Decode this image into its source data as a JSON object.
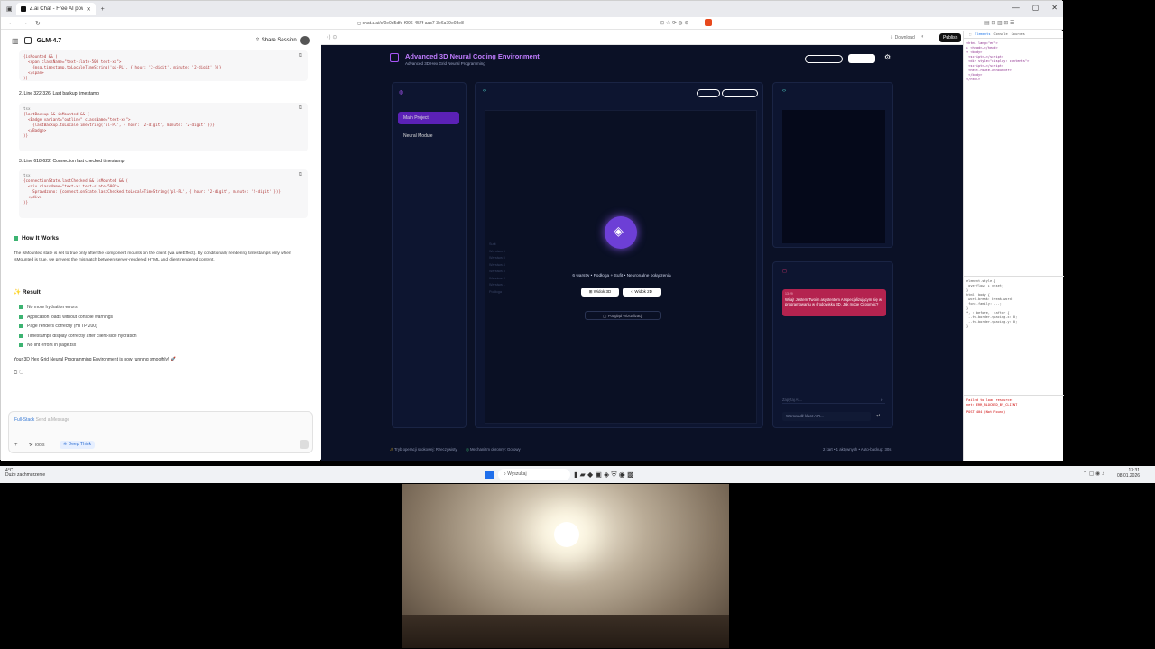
{
  "browser": {
    "tab_title": "Z.ai Chat - Free AI powered by GLM",
    "url": "chat.z.ai/c/0e0d5dfe-f096-457f-aac7-3e6a79e08e8"
  },
  "chat": {
    "model": "GLM-4.7",
    "share": "Share Session",
    "item2": "2. Line 322-326: Last backup timestamp",
    "item3": "3. Line 618-622: Connection last checked timestamp",
    "code_lang": "tsx",
    "code1": "{isMounted && (\n  <span className=\"text-slate-500 text-xs\">\n    {msg.timestamp.toLocaleTimeString('pl-PL', { hour: '2-digit', minute: '2-digit' })}\n  </span>\n)}",
    "code2": "{lastBackup && isMounted && (\n  <Badge variant=\"outline\" className=\"text-xs\">\n    {lastBackup.toLocaleTimeString('pl-PL', { hour: '2-digit', minute: '2-digit' })}\n  </Badge>\n)}",
    "code3": "{connectionState.lastChecked && isMounted && (\n  <div className=\"text-xs text-slate-500\">\n    Sprawdzono: {connectionState.lastChecked.toLocaleTimeString('pl-PL', { hour: '2-digit', minute: '2-digit' })}\n  </div>\n)}",
    "how_title": "How It Works",
    "how_text": "The isMounted state is set to true only after the component mounts on the client (via useEffect). By conditionally rendering timestamps only when isMounted is true, we prevent the mismatch between server-rendered HTML and client-rendered content.",
    "result_title": "Result",
    "results": [
      "No more hydration errors",
      "Application loads without console warnings",
      "Page renders correctly (HTTP 200)",
      "Timestamps display correctly after client-side hydration",
      "No lint errors in page.tsx"
    ],
    "final": "Your 3D Hex Grid Neural Programming Environment is now running smoothly! 🚀",
    "input_prefix": "Full-Stack",
    "input_placeholder": "Send a Message",
    "tools": "Tools",
    "deep": "Deep Think"
  },
  "app": {
    "title": "Advanced 3D Neural Coding Environment",
    "subtitle": "Advanced 3D Hex Grid Neural Programming",
    "download": "Download",
    "publish": "Publish",
    "projects": [
      "Main Project",
      "Neural Module"
    ],
    "layer_text": "6 warstw • Podłoga + Sufit • Neuronalne połączenia",
    "view3d": "Widok 3D",
    "view2d": "Widok 2D",
    "hide_vis": "Podgląd Wizualizacji",
    "layers": [
      "Sufit",
      "Warstwa 6",
      "Warstwa 5",
      "Warstwa 4",
      "Warstwa 3",
      "Warstwa 2",
      "Warstwa 1",
      "Podłoga"
    ],
    "ai_msg": "Witaj! Jestem Twoim asystentem AI specjalizującym się w programowaniu w środowisku 3D. Jak mogę Ci pomóc?",
    "ai_time": "13:29",
    "chat_placeholder": "Zapytaj AI...",
    "api_placeholder": "Wprowadź klucz API...",
    "footer_left": "Tryb operacji skokowej: Rzeczywisty",
    "footer_mid": "Mechanizm obronny: Gotowy",
    "footer_right": "2 kart • 1 aktywnych • Auto-backup: 30s"
  },
  "devtools": {
    "tabs": [
      "Elements",
      "Console",
      "Sources"
    ],
    "console_err": "Failed to load resource: net::ERR_BLOCKED_BY_CLIENT",
    "post_err": "POST 404 (Not Found)"
  },
  "taskbar": {
    "search": "Wyszukaj",
    "weather": "4°C",
    "weather_sub": "Duże zachmurzenie",
    "time": "13:31",
    "date": "08.01.2026"
  },
  "colors": {
    "accent": "#8b5cf6",
    "pink": "#d6336c",
    "app_bg": "#0b1126"
  }
}
